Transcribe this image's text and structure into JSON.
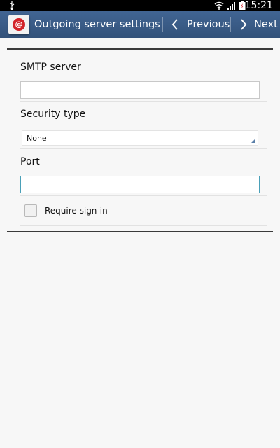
{
  "status_bar": {
    "time": "15:21",
    "icons": [
      "usb-icon",
      "wifi-icon",
      "signal-icon",
      "battery-icon"
    ]
  },
  "action_bar": {
    "app_icon": "email-at-icon",
    "app_icon_glyph": "@",
    "title": "Outgoing server settings",
    "previous_label": "Previous",
    "next_label": "Next"
  },
  "form": {
    "smtp_label": "SMTP server",
    "smtp_value": "",
    "security_label": "Security type",
    "security_value": "None",
    "port_label": "Port",
    "port_value": "",
    "require_signin_label": "Require sign-in",
    "require_signin_checked": false
  },
  "colors": {
    "action_bar": "#3a5a84",
    "focus_border": "#4aa0b8",
    "app_icon_red": "#d3242a"
  }
}
